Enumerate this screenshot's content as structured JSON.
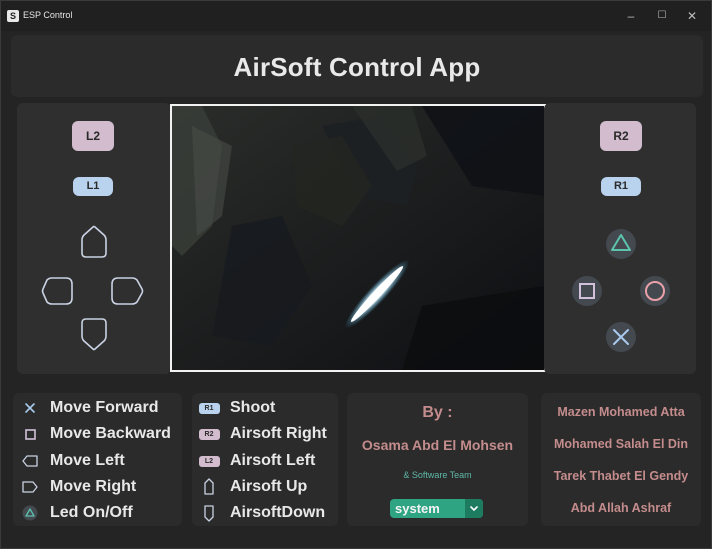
{
  "window": {
    "title": "ESP Control",
    "minimize": "–",
    "maximize": "☐",
    "close": "✕"
  },
  "header": {
    "title": "AirSoft Control App"
  },
  "controller": {
    "l2": "L2",
    "l1": "L1",
    "r2": "R2",
    "r1": "R1"
  },
  "legend_left": [
    {
      "icon": "cross-icon",
      "label": "Move Forward"
    },
    {
      "icon": "square-icon",
      "label": "Move Backward"
    },
    {
      "icon": "dpad-left-icon",
      "label": "Move  Left"
    },
    {
      "icon": "dpad-right-icon",
      "label": "Move  Right"
    },
    {
      "icon": "triangle-icon",
      "label": "Led On/Off"
    }
  ],
  "legend_right": [
    {
      "icon": "r1-chip",
      "chip": "R1",
      "label": "Shoot"
    },
    {
      "icon": "r2-chip",
      "chip": "R2",
      "label": "Airsoft Right"
    },
    {
      "icon": "l2-chip",
      "chip": "L2",
      "label": "Airsoft Left"
    },
    {
      "icon": "dpad-up-icon",
      "label": "Airsoft Up"
    },
    {
      "icon": "dpad-down-icon",
      "label": "AirsoftDown"
    }
  ],
  "credits": {
    "by_label": "By :",
    "author": "Osama Abd El Mohsen",
    "team": "& Software Team",
    "theme_selected": "system"
  },
  "team_members": [
    "Mazen Mohamed Atta",
    "Mohamed Salah El Din",
    "Tarek Thabet El Gendy",
    "Abd Allah Ashraf"
  ],
  "colors": {
    "accent_teal": "#2fa483",
    "credit_text": "#c48c8c",
    "trigger_pink": "#d2bccd",
    "bumper_blue": "#b9d3ee"
  }
}
